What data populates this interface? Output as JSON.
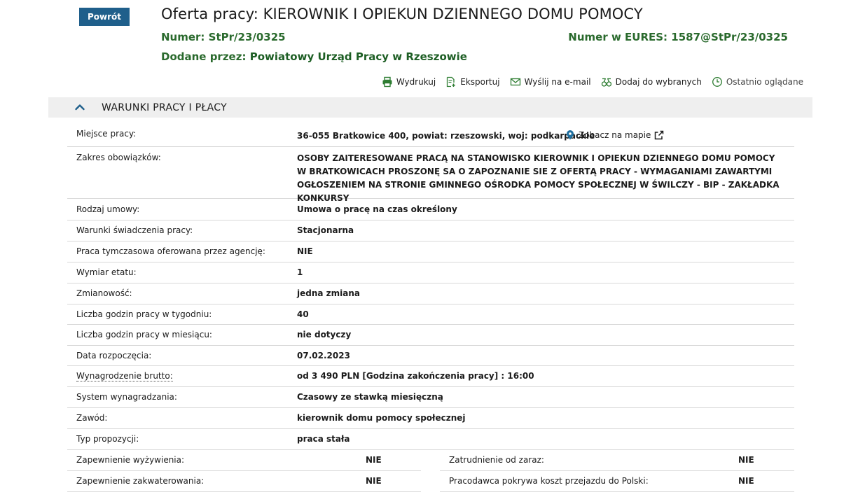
{
  "header": {
    "back_label": "Powrót",
    "title": "Oferta pracy: KIEROWNIK I OPIEKUN DZIENNEGO DOMU POMOCY",
    "number_label": "Numer:",
    "number_value": "StPr/23/0325",
    "eures_label": "Numer w EURES:",
    "eures_value": "1587@StPr/23/0325",
    "added_label": "Dodane przez:",
    "added_value": "Powiatowy Urząd Pracy w Rzeszowie"
  },
  "toolbar": {
    "print": "Wydrukuj",
    "export": "Eksportuj",
    "email": "Wyślij na e-mail",
    "favorites": "Dodaj do wybranych",
    "recent": "Ostatnio oglądane"
  },
  "section": {
    "title": "WARUNKI PRACY I PŁACY"
  },
  "map_link": "Zobacz na mapie",
  "rows": [
    {
      "label": "Miejsce pracy:",
      "value": "36-055 Bratkowice 400, powiat: rzeszowski, woj: podkarpackie"
    },
    {
      "label": "Zakres obowiązków:",
      "value": "OSOBY ZAITERESOWANE PRACĄ NA STANOWISKO KIEROWNIK I OPIEKUN DZIENNEGO DOMU POMOCY W BRATKOWICACH PROSZONĘ SA O ZAPOZNANIE SIE Z OFERTĄ PRACY - WYMAGANIAMI ZAWARTYMI OGŁOSZENIEM NA STRONIE GMINNEGO OŚRODKA POMOCY SPOŁECZNEJ W ŚWILCZY - BIP - ZAKŁADKA KONKURSY"
    },
    {
      "label": "Rodzaj umowy:",
      "value": "Umowa o pracę na czas określony"
    },
    {
      "label": "Warunki świadczenia pracy:",
      "value": "Stacjonarna"
    },
    {
      "label": "Praca tymczasowa oferowana przez agencję:",
      "value": "NIE"
    },
    {
      "label": "Wymiar etatu:",
      "value": "1"
    },
    {
      "label": "Zmianowość:",
      "value": "jedna zmiana"
    },
    {
      "label": "Liczba godzin pracy w tygodniu:",
      "value": "40"
    },
    {
      "label": "Liczba godzin pracy w miesiącu:",
      "value": "nie dotyczy"
    },
    {
      "label": "Data rozpoczęcia:",
      "value": "07.02.2023"
    },
    {
      "label": "Wynagrodzenie brutto:",
      "value": "od 3 490 PLN [Godzina zakończenia pracy] : 16:00"
    },
    {
      "label": "System wynagradzania:",
      "value": "Czasowy ze stawką miesięczną"
    },
    {
      "label": "Zawód:",
      "value": "kierownik domu pomocy społecznej"
    },
    {
      "label": "Typ propozycji:",
      "value": "praca stała"
    }
  ],
  "split_rows": [
    {
      "left_label": "Zapewnienie wyżywienia:",
      "left_value": "NIE",
      "right_label": "Zatrudnienie od zaraz:",
      "right_value": "NIE"
    },
    {
      "left_label": "Zapewnienie zakwaterowania:",
      "left_value": "NIE",
      "right_label": "Pracodawca pokrywa koszt przejazdu do Polski:",
      "right_value": "NIE"
    }
  ],
  "colors": {
    "primary_button": "#1f5f8b",
    "green_text": "#2a6a2d",
    "section_bg": "#efefef",
    "icon_green": "#2e7d32"
  }
}
